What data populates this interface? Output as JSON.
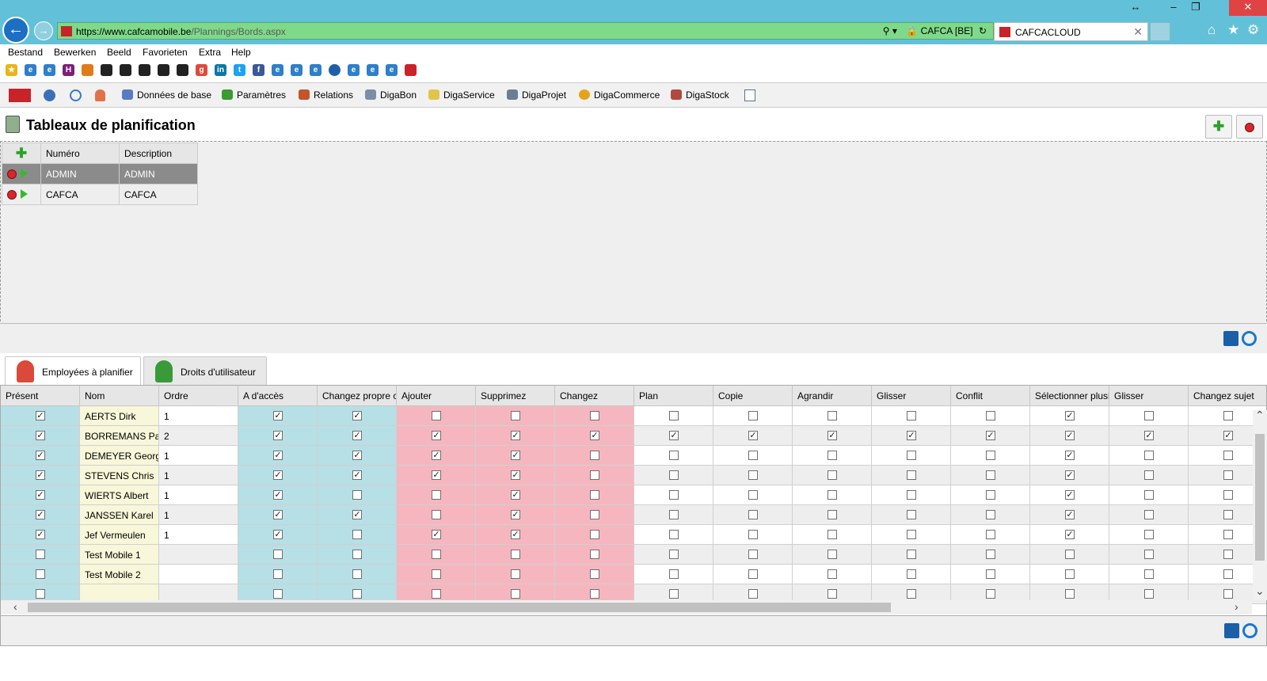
{
  "browser": {
    "url_domain": "https://www.cafcamobile.be",
    "url_path": "/Plannings/Bords.aspx",
    "site_identity": "CAFCA [BE]",
    "tab_title": "CAFCACLOUD"
  },
  "menu": [
    "Bestand",
    "Bewerken",
    "Beeld",
    "Favorieten",
    "Extra",
    "Help"
  ],
  "app_toolbar": [
    {
      "label": "Données de base",
      "icon": "database-icon",
      "color": "#5a7bbf"
    },
    {
      "label": "Paramètres",
      "icon": "gears-icon",
      "color": "#3b9a33"
    },
    {
      "label": "Relations",
      "icon": "people-icon",
      "color": "#c2562a"
    },
    {
      "label": "DigaBon",
      "icon": "document-icon",
      "color": "#7b8ea8"
    },
    {
      "label": "DigaService",
      "icon": "folder-icon",
      "color": "#e2c44a"
    },
    {
      "label": "DigaProjet",
      "icon": "project-icon",
      "color": "#6a7f96"
    },
    {
      "label": "DigaCommerce",
      "icon": "coin-icon",
      "color": "#e3a31b"
    },
    {
      "label": "DigaStock",
      "icon": "box-icon",
      "color": "#b2483e"
    }
  ],
  "page": {
    "title": "Tableaux de planification"
  },
  "boards": {
    "headers": {
      "number": "Numéro",
      "description": "Description"
    },
    "rows": [
      {
        "number": "ADMIN",
        "description": "ADMIN",
        "selected": true
      },
      {
        "number": "CAFCA",
        "description": "CAFCA",
        "selected": false
      }
    ]
  },
  "tabs": [
    {
      "label": "Employées à planifier",
      "active": true
    },
    {
      "label": "Droits d'utilisateur",
      "active": false
    }
  ],
  "grid": {
    "columns": [
      "Présent",
      "Nom",
      "Ordre",
      "A d'accès",
      "Changez propre c",
      "Ajouter",
      "Supprimez",
      "Changez",
      "Plan",
      "Copie",
      "Agrandir",
      "Glisser",
      "Conflit",
      "Sélectionner plusi",
      "Glisser",
      "Changez sujet"
    ],
    "rows": [
      {
        "name": "AERTS Dirk",
        "order": "1",
        "checks": [
          1,
          1,
          0,
          0,
          0,
          0,
          0,
          0,
          0,
          0,
          1,
          0,
          0,
          1
        ]
      },
      {
        "name": "BORREMANS Paul",
        "order": "2",
        "checks": [
          1,
          1,
          1,
          1,
          1,
          1,
          1,
          1,
          1,
          1,
          1,
          1,
          1,
          1
        ]
      },
      {
        "name": "DEMEYER George",
        "order": "1",
        "checks": [
          1,
          1,
          1,
          1,
          0,
          0,
          0,
          0,
          0,
          0,
          1,
          0,
          0,
          1
        ]
      },
      {
        "name": "STEVENS Chris",
        "order": "1",
        "checks": [
          1,
          1,
          1,
          1,
          0,
          0,
          0,
          0,
          0,
          0,
          1,
          0,
          0,
          1
        ]
      },
      {
        "name": "WIERTS Albert",
        "order": "1",
        "checks": [
          1,
          0,
          0,
          1,
          0,
          0,
          0,
          0,
          0,
          0,
          1,
          0,
          0,
          1
        ]
      },
      {
        "name": "JANSSEN Karel",
        "order": "1",
        "checks": [
          1,
          1,
          0,
          1,
          0,
          0,
          0,
          0,
          0,
          0,
          1,
          0,
          0,
          1
        ]
      },
      {
        "name": "Jef Vermeulen",
        "order": "1",
        "checks": [
          1,
          0,
          1,
          1,
          0,
          0,
          0,
          0,
          0,
          0,
          1,
          0,
          0,
          1
        ]
      },
      {
        "name": "Test Mobile 1",
        "order": "",
        "checks": [
          0,
          0,
          0,
          0,
          0,
          0,
          0,
          0,
          0,
          0,
          0,
          0,
          0,
          0
        ]
      },
      {
        "name": "Test Mobile 2",
        "order": "",
        "checks": [
          0,
          0,
          0,
          0,
          0,
          0,
          0,
          0,
          0,
          0,
          0,
          0,
          0,
          0
        ]
      },
      {
        "name": "",
        "order": "",
        "checks": [
          0,
          0,
          0,
          0,
          0,
          0,
          0,
          0,
          0,
          0,
          0,
          0,
          0,
          0
        ]
      }
    ]
  },
  "colors": {
    "chrome": "#62c1d8",
    "address_bar": "#7fd98a",
    "cyan_col": "#b7dfe6",
    "pink_col": "#f6b6c0",
    "name_col": "#f8f7d9",
    "selected_row": "#8b8b8b"
  }
}
